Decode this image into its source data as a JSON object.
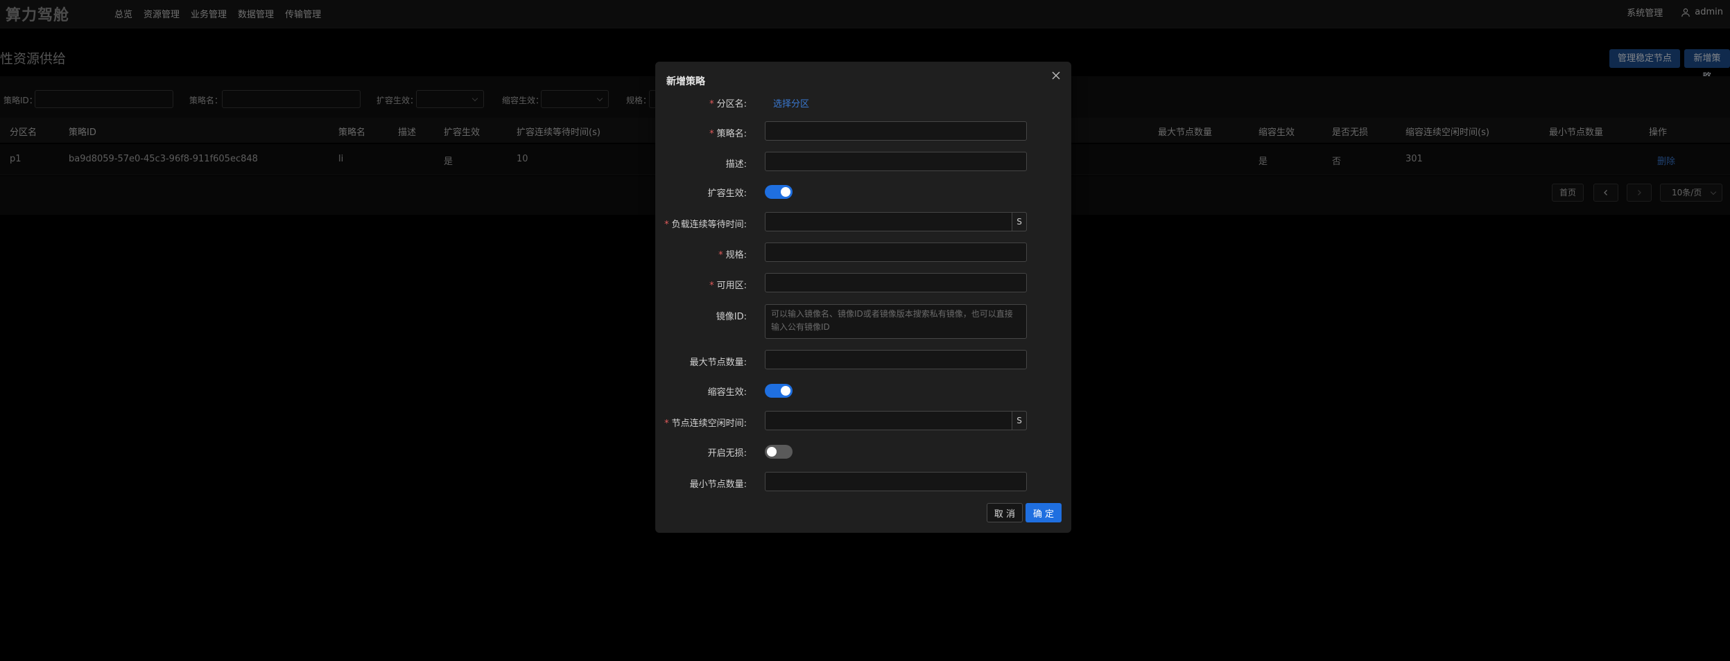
{
  "app": {
    "logo": "算力驾舱"
  },
  "nav": {
    "items": [
      "总览",
      "资源管理",
      "业务管理",
      "数据管理",
      "传输管理"
    ]
  },
  "top_right": {
    "system": "系统管理",
    "user": "admin"
  },
  "page": {
    "title": "性资源供给",
    "buttons": {
      "manage_nodes": "管理稳定节点",
      "new_policy": "新增策略"
    }
  },
  "filters": {
    "policy_id": "策略ID：",
    "policy_name": "策略名：",
    "scale_out": "扩容生效：",
    "scale_in": "缩容生效：",
    "spec": "规格："
  },
  "table": {
    "headers": {
      "partition": "分区名",
      "policy_id": "策略ID",
      "policy_name": "策略名",
      "desc": "描述",
      "scale_out": "扩容生效",
      "scale_out_wait": "扩容连续等待时间(s)",
      "max_nodes": "最大节点数量",
      "scale_in": "缩容生效",
      "lossless": "是否无损",
      "scale_in_idle": "缩容连续空闲时间(s)",
      "min_nodes": "最小节点数量",
      "actions": "操作"
    },
    "row": {
      "partition": "p1",
      "policy_id": "ba9d8059-57e0-45c3-96f8-911f605ec848",
      "policy_name": "li",
      "scale_out": "是",
      "scale_out_wait": "10",
      "scale_in": "是",
      "lossless": "否",
      "scale_in_idle": "301",
      "delete": "删除"
    }
  },
  "pagination": {
    "first": "首页",
    "page_size": "10条/页"
  },
  "modal": {
    "title": "新增策略",
    "fields": {
      "partition": "分区名:",
      "partition_link": "选择分区",
      "policy_name": "策略名:",
      "desc": "描述:",
      "scale_out": "扩容生效:",
      "load_wait": "负载连续等待时间:",
      "spec": "规格:",
      "zone": "可用区:",
      "image": "镜像ID:",
      "image_placeholder": "可以输入镜像名、镜像ID或者镜像版本搜索私有镜像，也可以直接输入公有镜像ID",
      "max_nodes": "最大节点数量:",
      "scale_in": "缩容生效:",
      "idle_time": "节点连续空闲时间:",
      "lossless": "开启无损:",
      "min_nodes": "最小节点数量:",
      "unit_s": "S"
    },
    "toggles": {
      "scale_out": true,
      "scale_in": true,
      "lossless": false
    },
    "cancel": "取 消",
    "ok": "确 定"
  }
}
